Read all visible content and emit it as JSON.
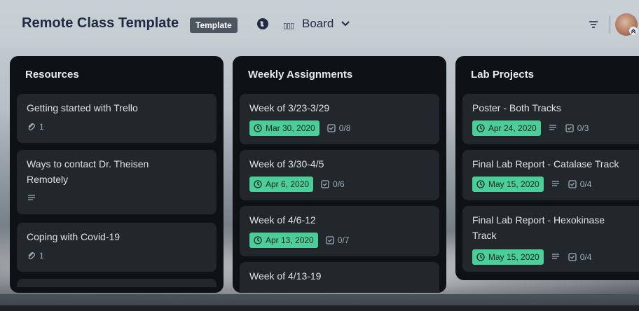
{
  "header": {
    "board_title": "Remote Class Template",
    "badge": "Template",
    "view_label": "Board",
    "view_icon_text": "▯▯▯"
  },
  "lists": [
    {
      "title": "Resources",
      "cards": [
        {
          "title": "Getting started with Trello",
          "attachments": "1"
        },
        {
          "title_line1": "Ways to contact Dr. Theisen",
          "title_line2": "Remotely"
        },
        {
          "title": "Coping with Covid-19",
          "attachments": "1"
        }
      ]
    },
    {
      "title": "Weekly Assignments",
      "cards": [
        {
          "title": "Week of 3/23-3/29",
          "due": "Mar 30, 2020",
          "checklist": "0/8"
        },
        {
          "title": "Week of 3/30-4/5",
          "due": "Apr 6, 2020",
          "checklist": "0/6"
        },
        {
          "title": "Week of 4/6-12",
          "due": "Apr 13, 2020",
          "checklist": "0/7"
        },
        {
          "title": "Week of 4/13-19"
        }
      ]
    },
    {
      "title": "Lab Projects",
      "cards": [
        {
          "title": "Poster - Both Tracks",
          "due": "Apr 24, 2020",
          "checklist": "0/3"
        },
        {
          "title": "Final Lab Report - Catalase Track",
          "due": "May 15, 2020",
          "checklist": "0/4"
        },
        {
          "title_line1": "Final Lab Report - Hexokinase",
          "title_line2": "Track",
          "due": "May 15, 2020",
          "checklist": "0/4"
        }
      ]
    }
  ],
  "colors": {
    "due_green": "#4bce97",
    "list_bg": "#0f1214",
    "card_bg": "#22272b"
  }
}
